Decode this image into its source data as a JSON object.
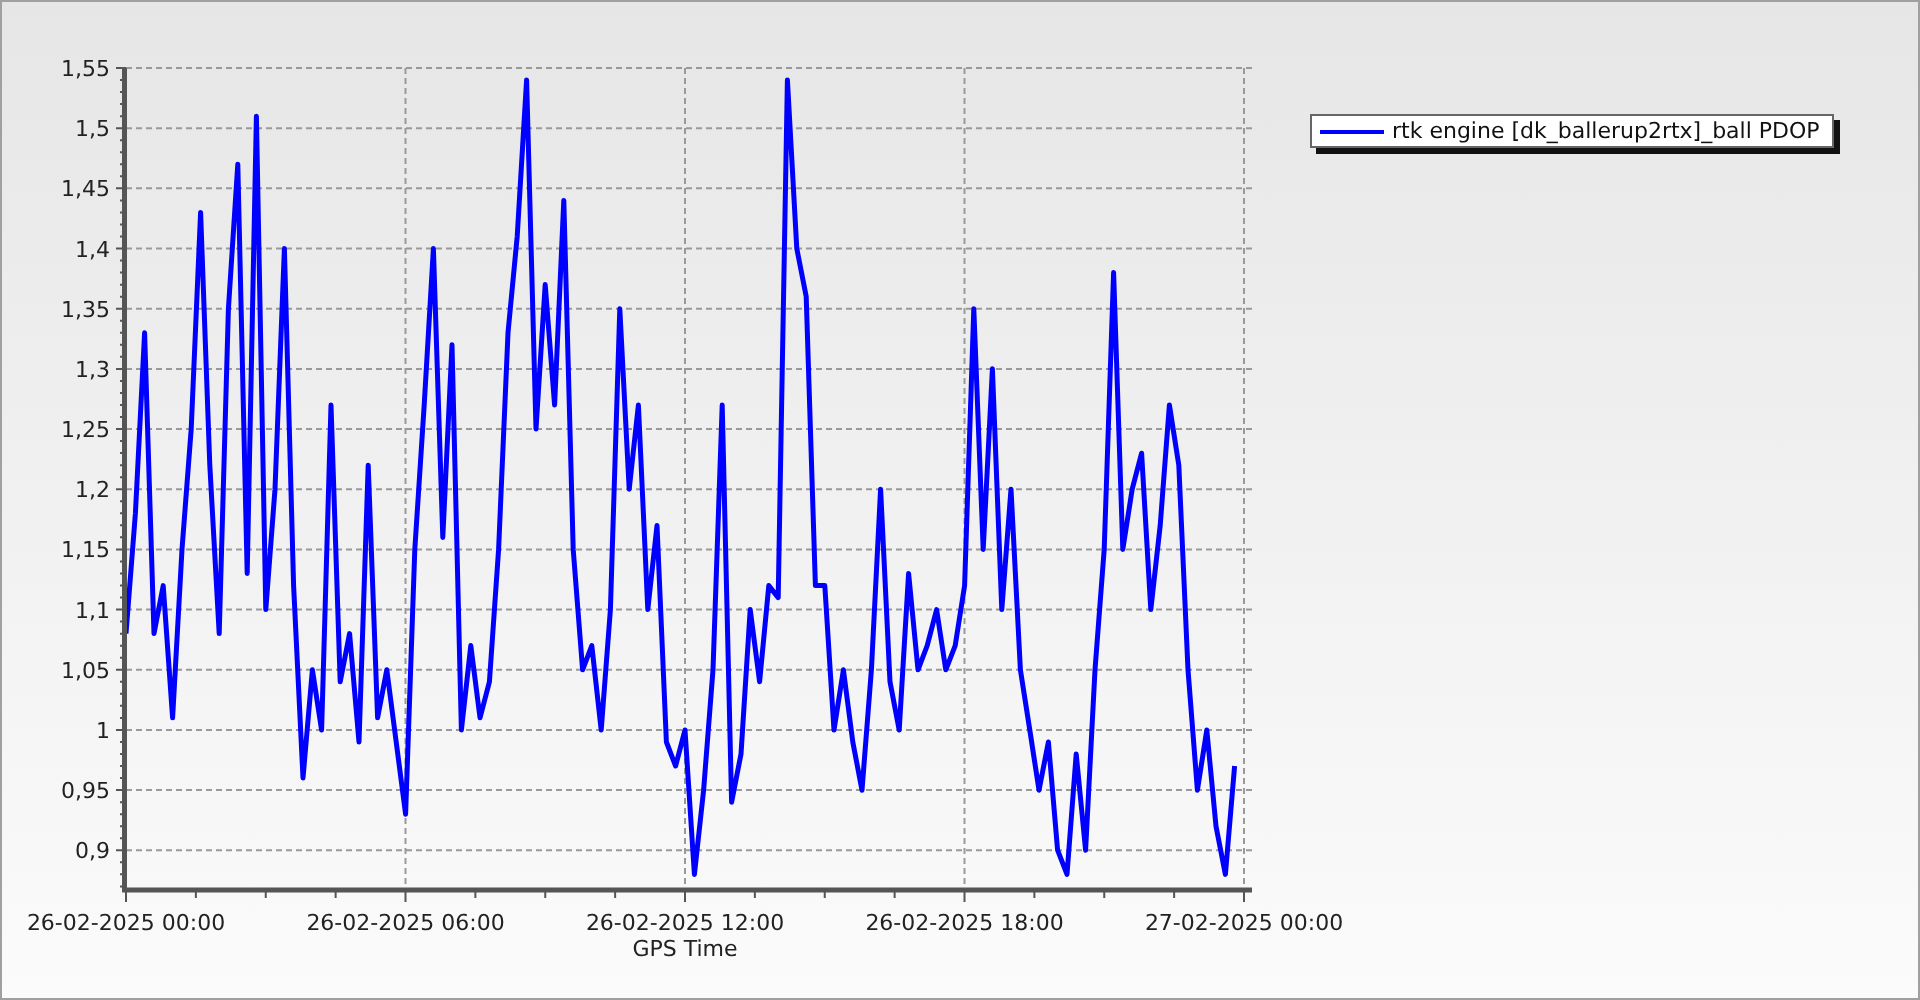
{
  "chart": {
    "chart_data": {
      "type": "line",
      "xlabel": "GPS Time",
      "grid": true,
      "categories": [
        "26-02-2025 00:00",
        null,
        null,
        null,
        null,
        null,
        null,
        null,
        null,
        null,
        null,
        null,
        null,
        null,
        null,
        null,
        null,
        null,
        null,
        null,
        null,
        null,
        null,
        null,
        null,
        null,
        null,
        null,
        null,
        null,
        "26-02-2025 06:00",
        null,
        null,
        null,
        null,
        null,
        null,
        null,
        null,
        null,
        null,
        null,
        null,
        null,
        null,
        null,
        null,
        null,
        null,
        null,
        null,
        null,
        null,
        null,
        null,
        null,
        null,
        null,
        null,
        null,
        "26-02-2025 12:00",
        null,
        null,
        null,
        null,
        null,
        null,
        null,
        null,
        null,
        null,
        null,
        null,
        null,
        null,
        null,
        null,
        null,
        null,
        null,
        null,
        null,
        null,
        null,
        null,
        null,
        null,
        null,
        null,
        null,
        "26-02-2025 18:00",
        null,
        null,
        null,
        null,
        null,
        null,
        null,
        null,
        null,
        null,
        null,
        null,
        null,
        null,
        null,
        null,
        null,
        null,
        null,
        null,
        null,
        null,
        null,
        null,
        null,
        null,
        null,
        null,
        null,
        "27-02-2025 00:00"
      ],
      "series": [
        {
          "name": "rtk engine [dk_ballerup2rtx]_ball PDOP",
          "color": "#0000ff",
          "values": [
            1.08,
            1.18,
            1.33,
            1.08,
            1.12,
            1.01,
            1.15,
            1.25,
            1.43,
            1.22,
            1.08,
            1.35,
            1.47,
            1.13,
            1.51,
            1.1,
            1.2,
            1.4,
            1.12,
            0.96,
            1.05,
            1.0,
            1.27,
            1.04,
            1.08,
            0.99,
            1.22,
            1.01,
            1.05,
            0.99,
            0.93,
            1.15,
            1.27,
            1.4,
            1.16,
            1.32,
            1.0,
            1.07,
            1.01,
            1.04,
            1.15,
            1.33,
            1.41,
            1.54,
            1.25,
            1.37,
            1.27,
            1.44,
            1.15,
            1.05,
            1.07,
            1.0,
            1.1,
            1.35,
            1.2,
            1.27,
            1.1,
            1.17,
            0.99,
            0.97,
            1.0,
            0.88,
            0.95,
            1.05,
            1.27,
            0.94,
            0.98,
            1.1,
            1.04,
            1.12,
            1.11,
            1.54,
            1.4,
            1.36,
            1.12,
            1.12,
            1.0,
            1.05,
            0.99,
            0.95,
            1.05,
            1.2,
            1.04,
            1.0,
            1.13,
            1.05,
            1.07,
            1.1,
            1.05,
            1.07,
            1.12,
            1.35,
            1.15,
            1.3,
            1.1,
            1.2,
            1.05,
            1.0,
            0.95,
            0.99,
            0.9,
            0.88,
            0.98,
            0.9,
            1.05,
            1.15,
            1.38,
            1.15,
            1.2,
            1.23,
            1.1,
            1.17,
            1.27,
            1.22,
            1.05,
            0.95,
            1.0,
            0.92,
            0.88,
            0.97,
            null
          ]
        }
      ],
      "ylim": [
        0.867,
        1.55
      ],
      "yticks": [
        {
          "value": 0.9,
          "label": "0,9"
        },
        {
          "value": 0.95,
          "label": "0,95"
        },
        {
          "value": 1,
          "label": "1"
        },
        {
          "value": 1.05,
          "label": "1,05"
        },
        {
          "value": 1.1,
          "label": "1,1"
        },
        {
          "value": 1.15,
          "label": "1,15"
        },
        {
          "value": 1.2,
          "label": "1,2"
        },
        {
          "value": 1.25,
          "label": "1,25"
        },
        {
          "value": 1.3,
          "label": "1,3"
        },
        {
          "value": 1.35,
          "label": "1,35"
        },
        {
          "value": 1.4,
          "label": "1,4"
        },
        {
          "value": 1.45,
          "label": "1,45"
        },
        {
          "value": 1.5,
          "label": "1,5"
        },
        {
          "value": 1.55,
          "label": "1,55"
        }
      ]
    }
  }
}
